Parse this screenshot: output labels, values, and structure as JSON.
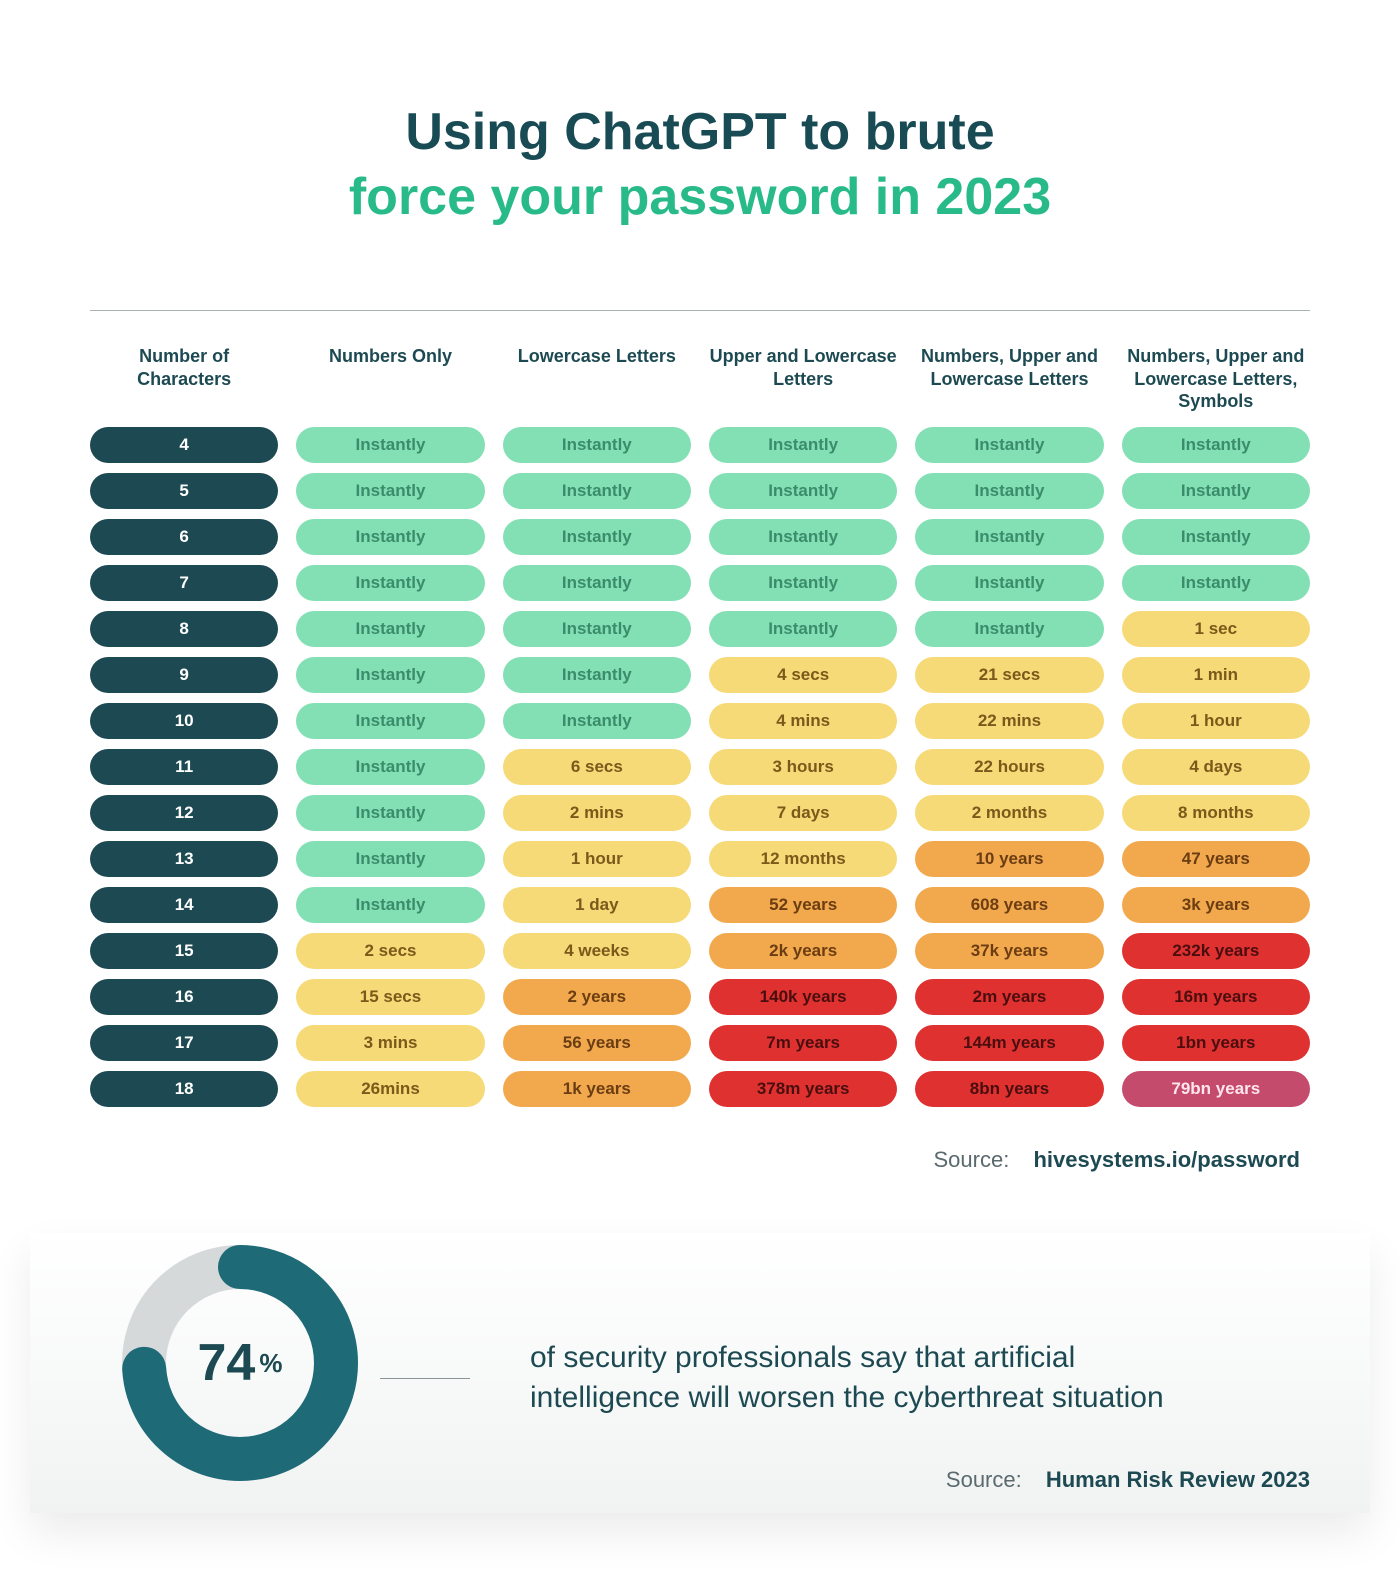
{
  "title": {
    "line1": "Using ChatGPT to brute",
    "line2": "force your password in 2023"
  },
  "chart_data": {
    "type": "table",
    "title": "Using ChatGPT to brute force your password in 2023",
    "columns": [
      "Number of Characters",
      "Numbers Only",
      "Lowercase Letters",
      "Upper and Lowercase Letters",
      "Numbers, Upper and Lowercase Letters",
      "Numbers, Upper and Lowercase Letters, Symbols"
    ],
    "legend": [
      "Instantly / green",
      "yellow",
      "orange",
      "red"
    ],
    "rows": [
      {
        "chars": "4",
        "cells": [
          {
            "v": "Instantly",
            "c": "green"
          },
          {
            "v": "Instantly",
            "c": "green"
          },
          {
            "v": "Instantly",
            "c": "green"
          },
          {
            "v": "Instantly",
            "c": "green"
          },
          {
            "v": "Instantly",
            "c": "green"
          }
        ]
      },
      {
        "chars": "5",
        "cells": [
          {
            "v": "Instantly",
            "c": "green"
          },
          {
            "v": "Instantly",
            "c": "green"
          },
          {
            "v": "Instantly",
            "c": "green"
          },
          {
            "v": "Instantly",
            "c": "green"
          },
          {
            "v": "Instantly",
            "c": "green"
          }
        ]
      },
      {
        "chars": "6",
        "cells": [
          {
            "v": "Instantly",
            "c": "green"
          },
          {
            "v": "Instantly",
            "c": "green"
          },
          {
            "v": "Instantly",
            "c": "green"
          },
          {
            "v": "Instantly",
            "c": "green"
          },
          {
            "v": "Instantly",
            "c": "green"
          }
        ]
      },
      {
        "chars": "7",
        "cells": [
          {
            "v": "Instantly",
            "c": "green"
          },
          {
            "v": "Instantly",
            "c": "green"
          },
          {
            "v": "Instantly",
            "c": "green"
          },
          {
            "v": "Instantly",
            "c": "green"
          },
          {
            "v": "Instantly",
            "c": "green"
          }
        ]
      },
      {
        "chars": "8",
        "cells": [
          {
            "v": "Instantly",
            "c": "green"
          },
          {
            "v": "Instantly",
            "c": "green"
          },
          {
            "v": "Instantly",
            "c": "green"
          },
          {
            "v": "Instantly",
            "c": "green"
          },
          {
            "v": "1 sec",
            "c": "yellow"
          }
        ]
      },
      {
        "chars": "9",
        "cells": [
          {
            "v": "Instantly",
            "c": "green"
          },
          {
            "v": "Instantly",
            "c": "green"
          },
          {
            "v": "4 secs",
            "c": "yellow"
          },
          {
            "v": "21 secs",
            "c": "yellow"
          },
          {
            "v": "1 min",
            "c": "yellow"
          }
        ]
      },
      {
        "chars": "10",
        "cells": [
          {
            "v": "Instantly",
            "c": "green"
          },
          {
            "v": "Instantly",
            "c": "green"
          },
          {
            "v": "4 mins",
            "c": "yellow"
          },
          {
            "v": "22 mins",
            "c": "yellow"
          },
          {
            "v": "1 hour",
            "c": "yellow"
          }
        ]
      },
      {
        "chars": "11",
        "cells": [
          {
            "v": "Instantly",
            "c": "green"
          },
          {
            "v": "6 secs",
            "c": "yellow"
          },
          {
            "v": "3 hours",
            "c": "yellow"
          },
          {
            "v": "22 hours",
            "c": "yellow"
          },
          {
            "v": "4 days",
            "c": "yellow"
          }
        ]
      },
      {
        "chars": "12",
        "cells": [
          {
            "v": "Instantly",
            "c": "green"
          },
          {
            "v": "2 mins",
            "c": "yellow"
          },
          {
            "v": "7 days",
            "c": "yellow"
          },
          {
            "v": "2 months",
            "c": "yellow"
          },
          {
            "v": "8 months",
            "c": "yellow"
          }
        ]
      },
      {
        "chars": "13",
        "cells": [
          {
            "v": "Instantly",
            "c": "green"
          },
          {
            "v": "1 hour",
            "c": "yellow"
          },
          {
            "v": "12 months",
            "c": "yellow"
          },
          {
            "v": "10 years",
            "c": "orange"
          },
          {
            "v": "47 years",
            "c": "orange"
          }
        ]
      },
      {
        "chars": "14",
        "cells": [
          {
            "v": "Instantly",
            "c": "green"
          },
          {
            "v": "1 day",
            "c": "yellow"
          },
          {
            "v": "52 years",
            "c": "orange"
          },
          {
            "v": "608 years",
            "c": "orange"
          },
          {
            "v": "3k years",
            "c": "orange"
          }
        ]
      },
      {
        "chars": "15",
        "cells": [
          {
            "v": "2 secs",
            "c": "yellow"
          },
          {
            "v": "4 weeks",
            "c": "yellow"
          },
          {
            "v": "2k years",
            "c": "orange"
          },
          {
            "v": "37k years",
            "c": "orange"
          },
          {
            "v": "232k years",
            "c": "red"
          }
        ]
      },
      {
        "chars": "16",
        "cells": [
          {
            "v": "15 secs",
            "c": "yellow"
          },
          {
            "v": "2 years",
            "c": "orange"
          },
          {
            "v": "140k years",
            "c": "red"
          },
          {
            "v": "2m years",
            "c": "red"
          },
          {
            "v": "16m years",
            "c": "red"
          }
        ]
      },
      {
        "chars": "17",
        "cells": [
          {
            "v": "3 mins",
            "c": "yellow"
          },
          {
            "v": "56 years",
            "c": "orange"
          },
          {
            "v": "7m years",
            "c": "red"
          },
          {
            "v": "144m years",
            "c": "red"
          },
          {
            "v": "1bn years",
            "c": "red"
          }
        ]
      },
      {
        "chars": "18",
        "cells": [
          {
            "v": "26mins",
            "c": "yellow"
          },
          {
            "v": "1k years",
            "c": "orange"
          },
          {
            "v": "378m years",
            "c": "red"
          },
          {
            "v": "8bn  years",
            "c": "red"
          },
          {
            "v": "79bn years",
            "c": "redalt"
          }
        ]
      }
    ],
    "source": "hivesystems.io/password"
  },
  "source_label": "Source:",
  "stat": {
    "percent": 74,
    "percent_label": "74",
    "percent_sign": "%",
    "text": "of security professionals say that artificial intelligence will worsen the cyberthreat situation",
    "source": "Human Risk Review 2023"
  }
}
